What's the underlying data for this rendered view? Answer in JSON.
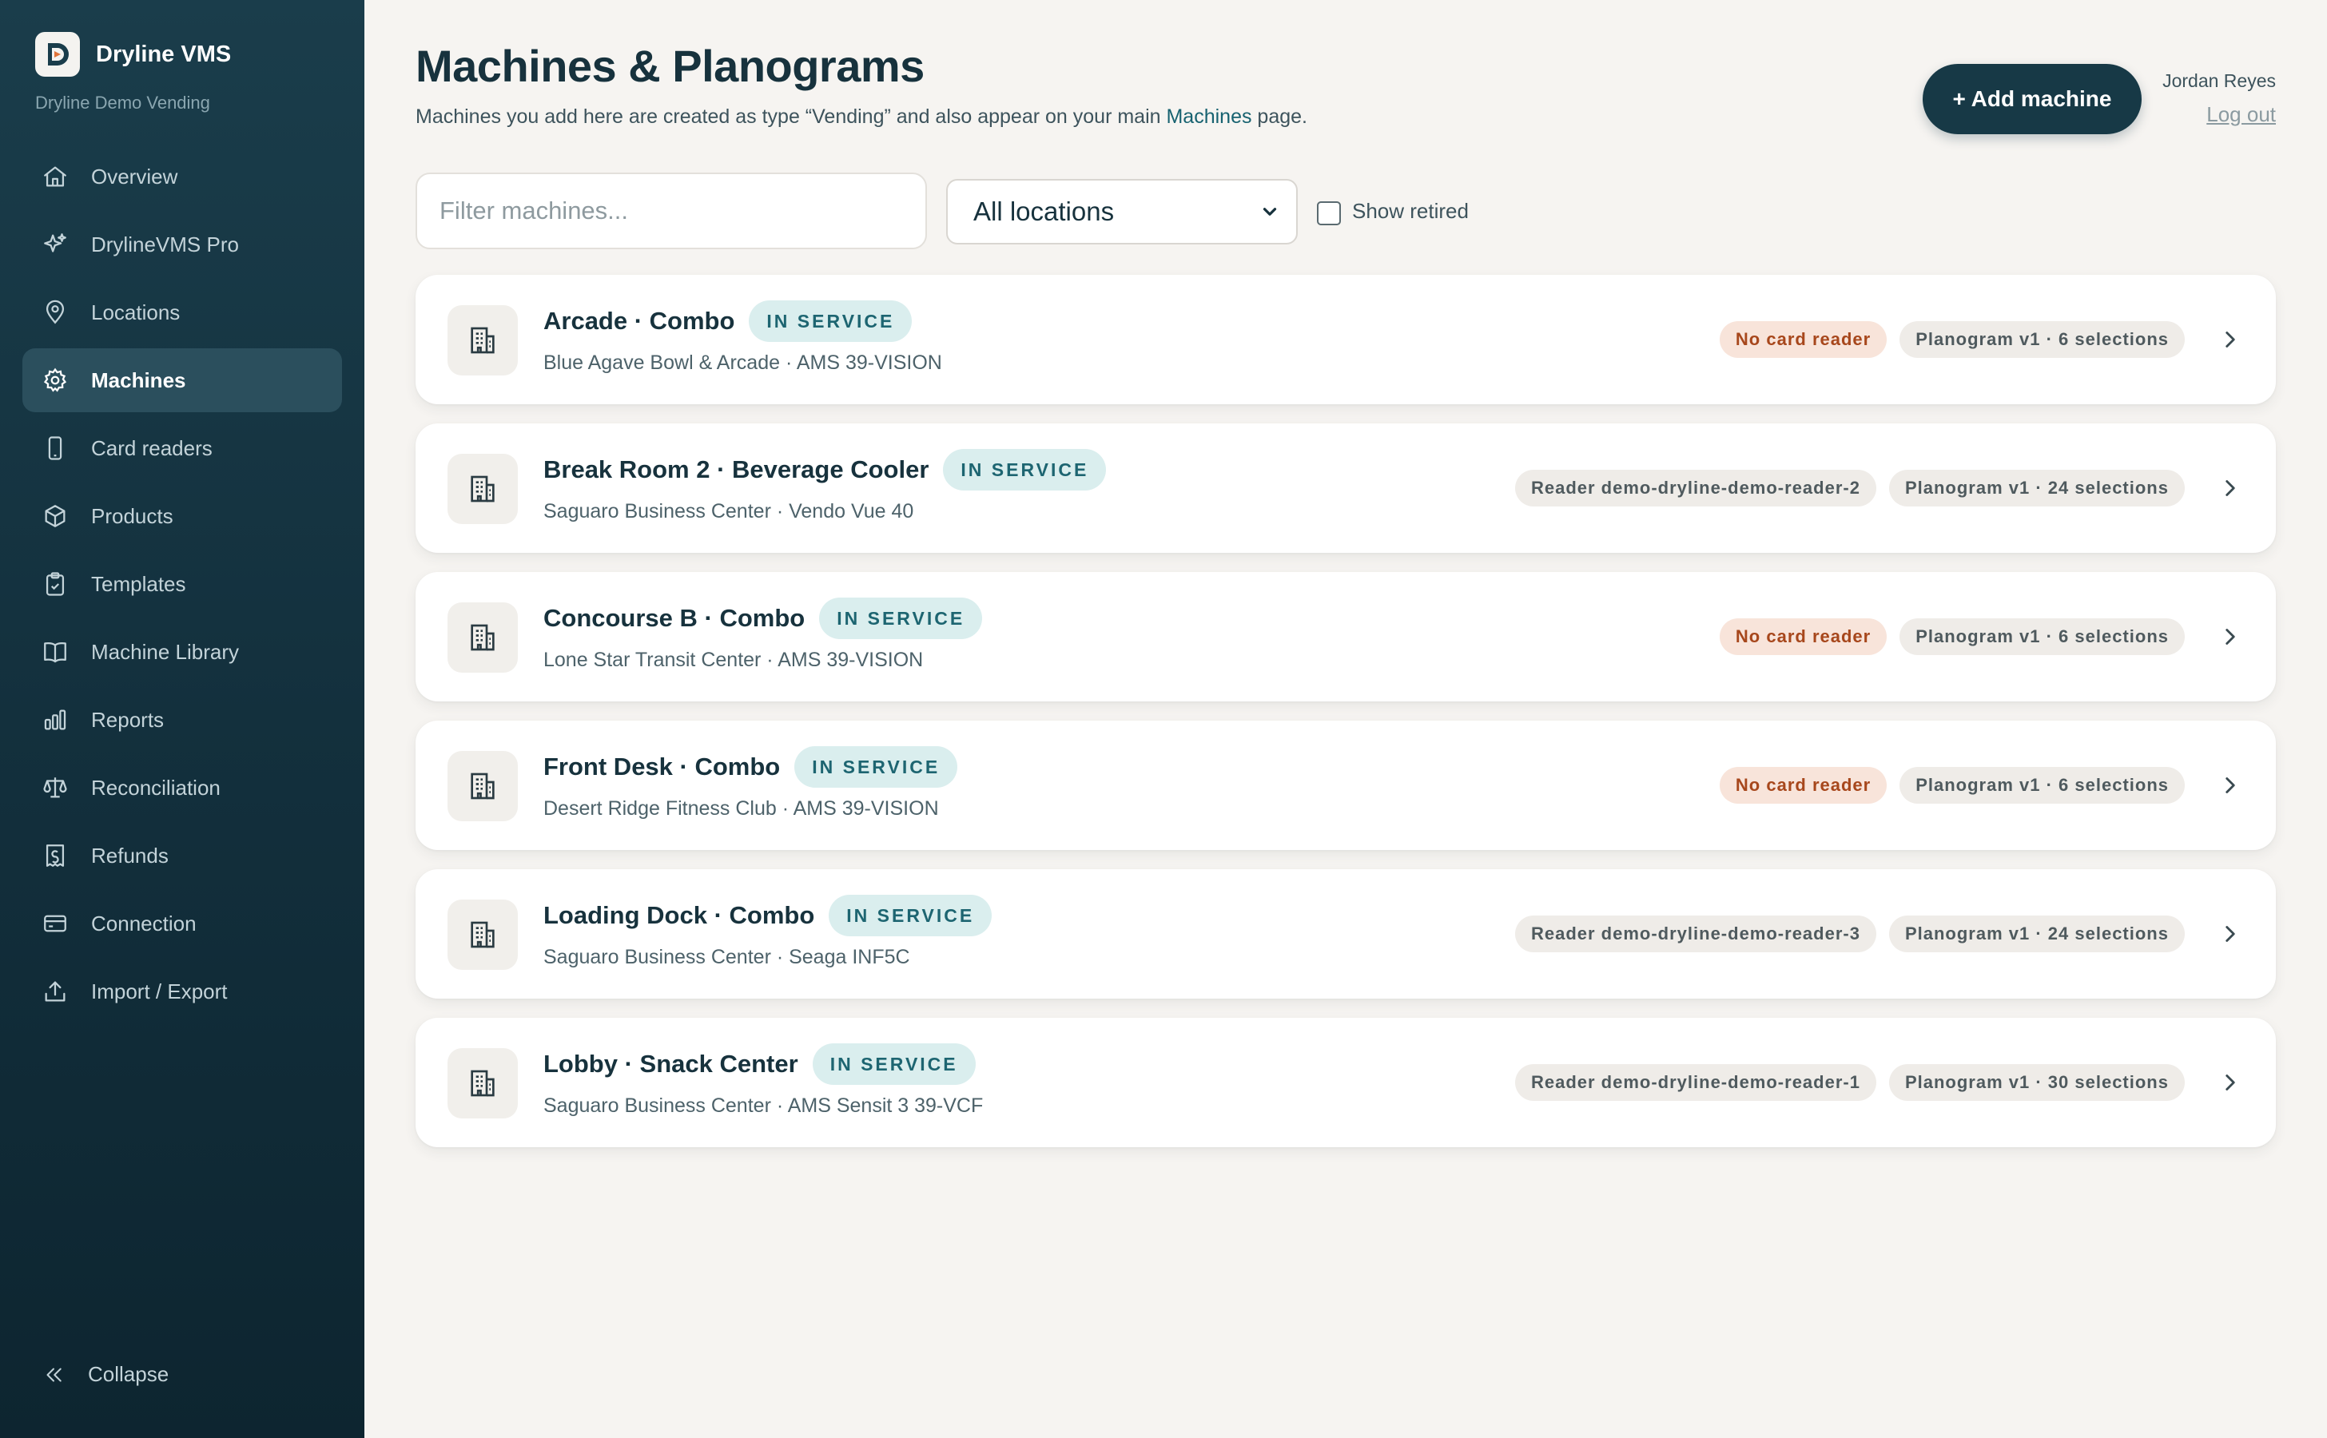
{
  "brand": {
    "name": "Dryline VMS",
    "subtitle": "Dryline Demo Vending"
  },
  "nav": {
    "items": [
      {
        "label": "Overview",
        "icon": "home-icon"
      },
      {
        "label": "DrylineVMS Pro",
        "icon": "sparkle-icon"
      },
      {
        "label": "Locations",
        "icon": "map-pin-icon"
      },
      {
        "label": "Machines",
        "icon": "gear-icon",
        "active": true
      },
      {
        "label": "Card readers",
        "icon": "phone-icon"
      },
      {
        "label": "Products",
        "icon": "box-icon"
      },
      {
        "label": "Templates",
        "icon": "clipboard-icon"
      },
      {
        "label": "Machine Library",
        "icon": "book-icon"
      },
      {
        "label": "Reports",
        "icon": "bar-chart-icon"
      },
      {
        "label": "Reconciliation",
        "icon": "scale-icon"
      },
      {
        "label": "Refunds",
        "icon": "receipt-icon"
      },
      {
        "label": "Connection",
        "icon": "credit-card-icon"
      },
      {
        "label": "Import / Export",
        "icon": "upload-icon"
      }
    ],
    "collapse_label": "Collapse"
  },
  "header": {
    "title": "Machines & Planograms",
    "subtitle_before": "Machines you add here are created as type “Vending” and also appear on your main ",
    "subtitle_link": "Machines",
    "subtitle_after": " page.",
    "add_button": "+ Add machine",
    "user_name": "Jordan Reyes",
    "logout": "Log out"
  },
  "filters": {
    "search_placeholder": "Filter machines...",
    "location_selected": "All locations",
    "show_retired_label": "Show retired",
    "show_retired_checked": false
  },
  "colors": {
    "sidebar_bg": "#16323e",
    "accent": "#173946",
    "service_badge_bg": "#daeeee",
    "service_badge_text": "#1d6571",
    "warn_pill_bg": "#f8e4da",
    "warn_pill_text": "#a7471c"
  },
  "machines": [
    {
      "name": "Arcade · Combo",
      "status": "IN SERVICE",
      "location": "Blue Agave Bowl & Arcade · AMS 39-VISION",
      "reader": "No card reader",
      "reader_missing": true,
      "planogram": "Planogram v1 · 6 selections"
    },
    {
      "name": "Break Room 2 · Beverage Cooler",
      "status": "IN SERVICE",
      "location": "Saguaro Business Center · Vendo Vue 40",
      "reader": "Reader demo-dryline-demo-reader-2",
      "reader_missing": false,
      "planogram": "Planogram v1 · 24 selections"
    },
    {
      "name": "Concourse B · Combo",
      "status": "IN SERVICE",
      "location": "Lone Star Transit Center · AMS 39-VISION",
      "reader": "No card reader",
      "reader_missing": true,
      "planogram": "Planogram v1 · 6 selections"
    },
    {
      "name": "Front Desk · Combo",
      "status": "IN SERVICE",
      "location": "Desert Ridge Fitness Club · AMS 39-VISION",
      "reader": "No card reader",
      "reader_missing": true,
      "planogram": "Planogram v1 · 6 selections"
    },
    {
      "name": "Loading Dock · Combo",
      "status": "IN SERVICE",
      "location": "Saguaro Business Center · Seaga INF5C",
      "reader": "Reader demo-dryline-demo-reader-3",
      "reader_missing": false,
      "planogram": "Planogram v1 · 24 selections"
    },
    {
      "name": "Lobby · Snack Center",
      "status": "IN SERVICE",
      "location": "Saguaro Business Center · AMS Sensit 3 39-VCF",
      "reader": "Reader demo-dryline-demo-reader-1",
      "reader_missing": false,
      "planogram": "Planogram v1 · 30 selections"
    }
  ]
}
